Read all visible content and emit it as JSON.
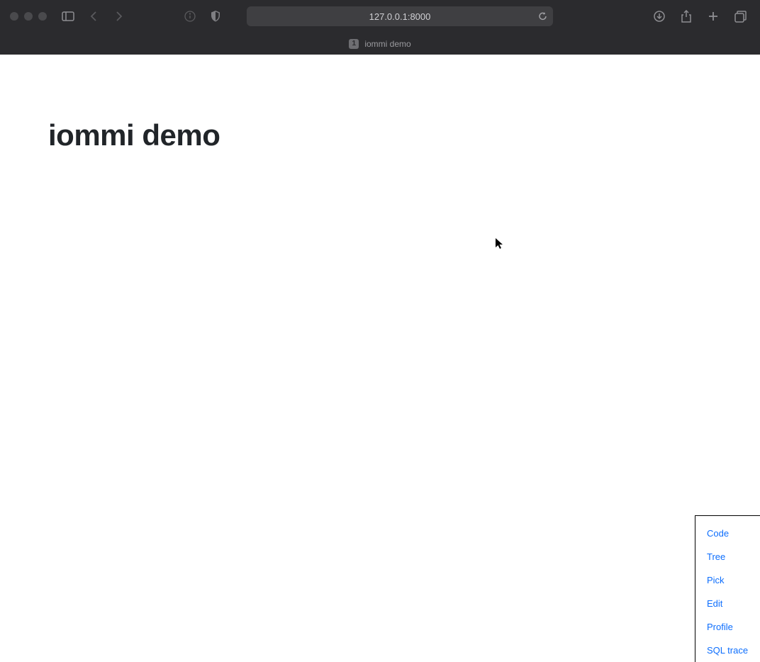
{
  "browser": {
    "address": "127.0.0.1:8000",
    "tab": {
      "badge": "1",
      "title": "iommi demo"
    }
  },
  "page": {
    "title": "iommi demo"
  },
  "debug_toolbar": {
    "items": [
      "Code",
      "Tree",
      "Pick",
      "Edit",
      "Profile",
      "SQL trace"
    ]
  }
}
